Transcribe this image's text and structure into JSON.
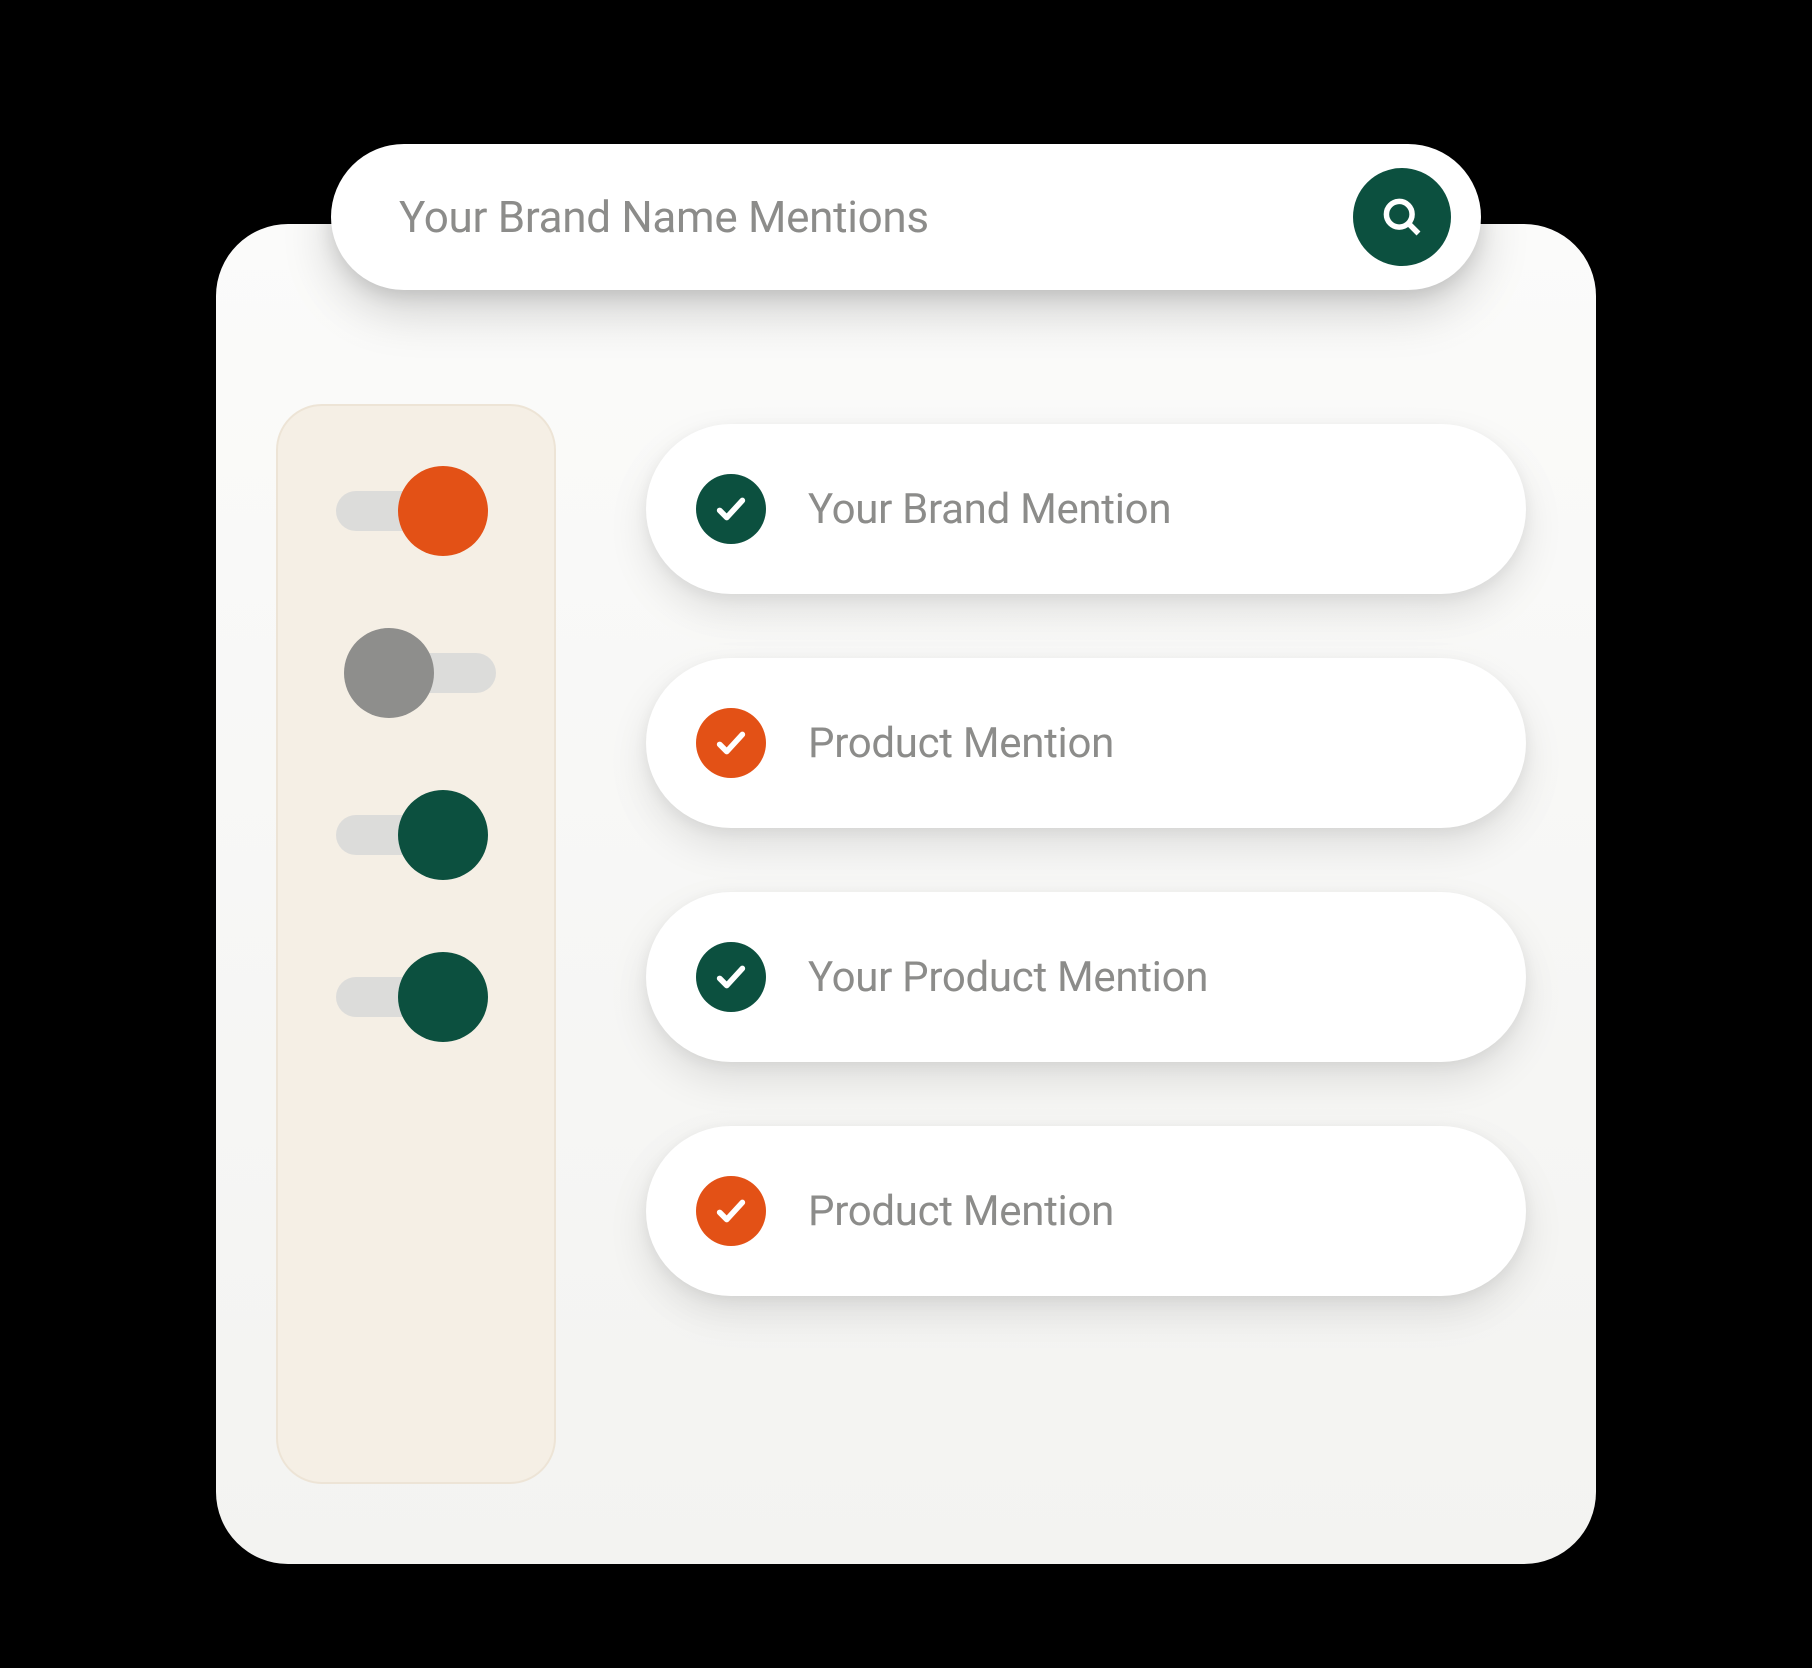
{
  "colors": {
    "green": "#0c503f",
    "orange": "#e35116",
    "gray": "#8e8e8c"
  },
  "search": {
    "placeholder": "Your Brand Name Mentions"
  },
  "filters": [
    {
      "name": "toggle-1",
      "color": "orange",
      "state": "on"
    },
    {
      "name": "toggle-2",
      "color": "gray",
      "state": "off"
    },
    {
      "name": "toggle-3",
      "color": "green",
      "state": "on"
    },
    {
      "name": "toggle-4",
      "color": "green",
      "state": "on"
    }
  ],
  "mentions": [
    {
      "label": "Your Brand Mention",
      "badge_color": "green"
    },
    {
      "label": "Product Mention",
      "badge_color": "orange"
    },
    {
      "label": "Your Product Mention",
      "badge_color": "green"
    },
    {
      "label": "Product Mention",
      "badge_color": "orange"
    }
  ]
}
